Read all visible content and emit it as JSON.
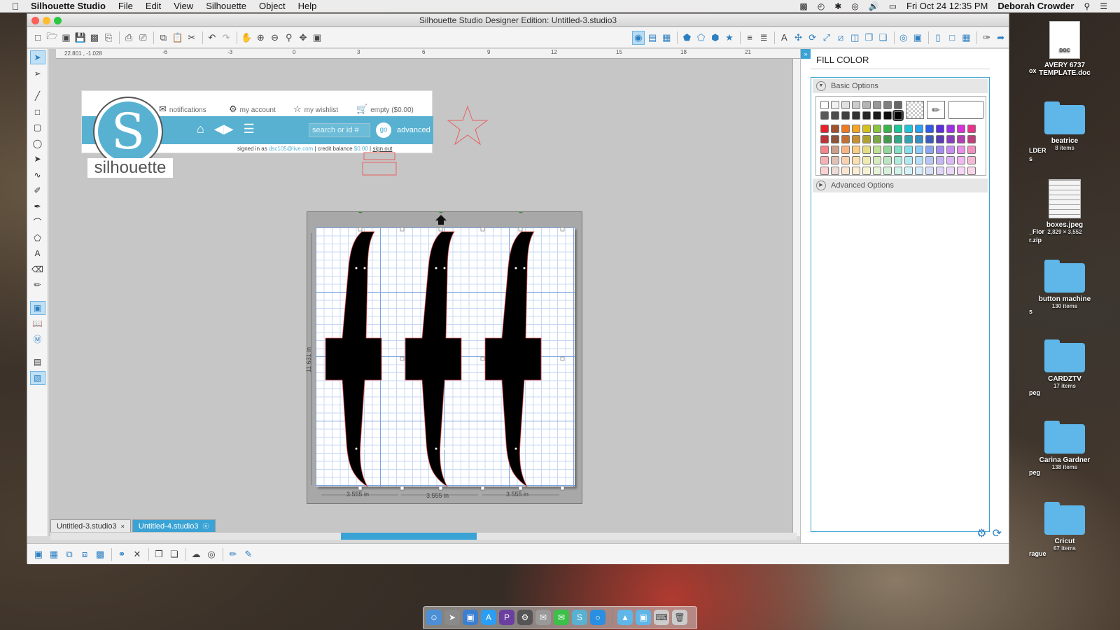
{
  "menubar": {
    "app_name": "Silhouette Studio",
    "items": [
      "File",
      "Edit",
      "View",
      "Silhouette",
      "Object",
      "Help"
    ],
    "clock": "Fri Oct 24  12:35 PM",
    "user": "Deborah Crowder"
  },
  "window": {
    "title": "Silhouette Studio Designer Edition: Untitled-3.studio3"
  },
  "ruler": {
    "coords": "22.801 , -1.028",
    "labels": [
      "-6",
      "-3",
      "0",
      "3",
      "6",
      "9",
      "12",
      "15",
      "18",
      "21"
    ]
  },
  "banner": {
    "logo_letter": "S",
    "logo_word": "silhouette",
    "notifications": "notifications",
    "my_account": "my account",
    "my_wishlist": "my wishlist",
    "cart": "empty ($0.00)",
    "search_placeholder": "search or id #",
    "go": "go",
    "advanced": "advanced",
    "signed_in_prefix": "signed in as",
    "signed_in_email": "dsc105@live.com",
    "credit_label": "| credit balance",
    "credit_value": "$0.00",
    "sign_out": "sign out"
  },
  "mat": {
    "dimension_labels": [
      "3.555 in",
      "3.555 in",
      "3.555 in"
    ],
    "height_label": "11.631 in"
  },
  "tabs": [
    {
      "label": "Untitled-3.studio3",
      "active": false
    },
    {
      "label": "Untitled-4.studio3",
      "active": true
    }
  ],
  "panel": {
    "title": "FILL COLOR",
    "basic_options": "Basic Options",
    "advanced_options": "Advanced Options"
  },
  "palette": {
    "grays": [
      "#ffffff",
      "#f2f2f2",
      "#e0e0e0",
      "#cccccc",
      "#b3b3b3",
      "#999999",
      "#808080",
      "#666666",
      "#595959",
      "#4d4d4d",
      "#404040",
      "#333333",
      "#262626",
      "#1a1a1a",
      "#0d0d0d",
      "#000000"
    ],
    "hues": [
      "#e8202a",
      "#a0522d",
      "#f07820",
      "#f5a623",
      "#d4c21c",
      "#8cc63f",
      "#39b54a",
      "#1bc99a",
      "#20c4d8",
      "#2aa3f0",
      "#2e5ce6",
      "#5a2de0",
      "#9b30e6",
      "#d633d6",
      "#e8338a"
    ]
  },
  "desktop": {
    "items": [
      {
        "name": "AVERY 6737 TEMPLATE.doc",
        "sub": "",
        "type": "doc",
        "badge": "DOC"
      },
      {
        "name": "beatrice",
        "sub": "8 items",
        "type": "folder"
      },
      {
        "name": "boxes.jpeg",
        "sub": "2,829 × 3,552",
        "type": "jpg"
      },
      {
        "name": "button machine",
        "sub": "130 items",
        "type": "folder"
      },
      {
        "name": "CARDZTV",
        "sub": "17 items",
        "type": "folder"
      },
      {
        "name": "Carina Gardner",
        "sub": "138 items",
        "type": "folder"
      },
      {
        "name": "Cricut",
        "sub": "67 items",
        "type": "folder"
      }
    ],
    "partial_labels": [
      "ox",
      "LDER",
      "s",
      "_Flor",
      "r.zip",
      "s",
      "peg",
      "peg",
      "rague"
    ]
  },
  "colors": {
    "accent": "#3aa3d5",
    "silhouette_blue": "#58b1d1"
  }
}
